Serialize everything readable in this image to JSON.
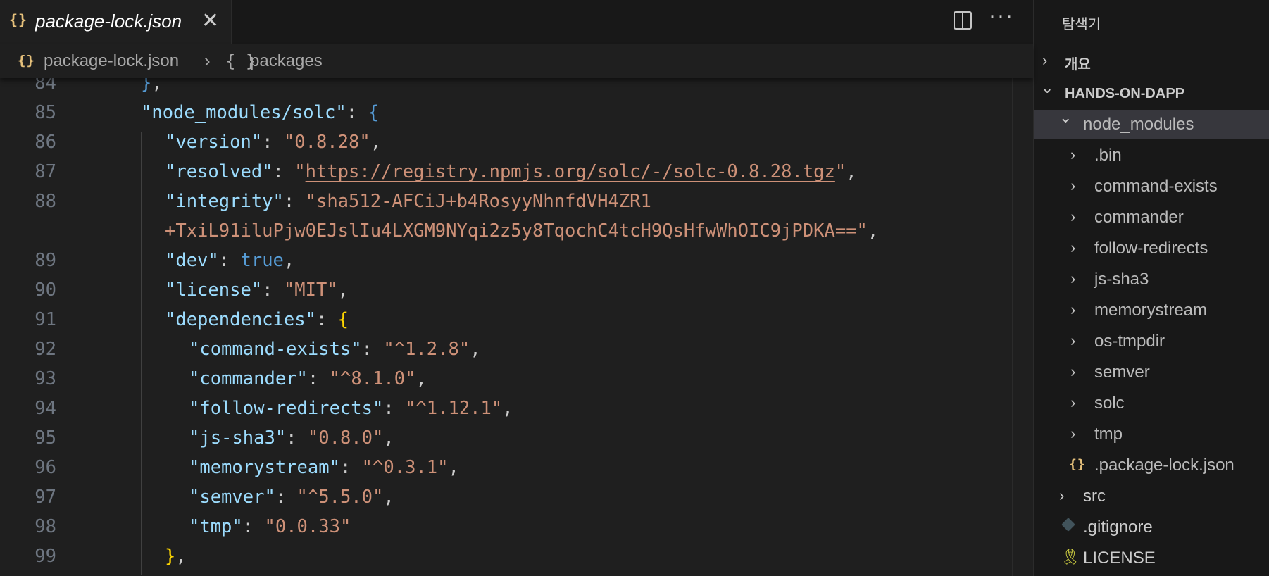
{
  "editor": {
    "tab": {
      "icon": "json-braces-icon",
      "title": "package-lock.json",
      "close": "✕"
    },
    "actions": {
      "split": "split-editor-icon",
      "more": "···"
    },
    "breadcrumb": {
      "file": "package-lock.json",
      "separator": "›",
      "object_icon": "{ }",
      "object": "packages"
    },
    "lines": [
      {
        "n": "84",
        "indent": 2,
        "tokens": [
          [
            "}",
            "b"
          ],
          [
            ",",
            "p"
          ]
        ]
      },
      {
        "n": "85",
        "indent": 2,
        "tokens": [
          [
            "\"node_modules/solc\"",
            "k"
          ],
          [
            ": ",
            "p"
          ],
          [
            "{",
            "b"
          ]
        ]
      },
      {
        "n": "86",
        "indent": 3,
        "tokens": [
          [
            "\"version\"",
            "k"
          ],
          [
            ": ",
            "p"
          ],
          [
            "\"0.8.28\"",
            "s"
          ],
          [
            ",",
            "p"
          ]
        ]
      },
      {
        "n": "87",
        "indent": 3,
        "tokens": [
          [
            "\"resolved\"",
            "k"
          ],
          [
            ": ",
            "p"
          ],
          [
            "\"",
            "s"
          ],
          [
            "https://registry.npmjs.org/solc/-/solc-0.8.28.tgz",
            "s u"
          ],
          [
            "\"",
            "s"
          ],
          [
            ",",
            "p"
          ]
        ]
      },
      {
        "n": "88",
        "indent": 3,
        "tokens": [
          [
            "\"integrity\"",
            "k"
          ],
          [
            ": ",
            "p"
          ],
          [
            "\"sha512-AFCiJ+b4RosyyNhnfdVH4ZR1",
            "s"
          ]
        ]
      },
      {
        "n": "",
        "indent": 3,
        "tokens": [
          [
            "+TxiL91iluPjw0EJslIu4LXGM9NYqi2z5y8TqochC4tcH9QsHfwWhOIC9jPDKA==\"",
            "s"
          ],
          [
            ",",
            "p"
          ]
        ]
      },
      {
        "n": "89",
        "indent": 3,
        "tokens": [
          [
            "\"dev\"",
            "k"
          ],
          [
            ": ",
            "p"
          ],
          [
            "true",
            "b"
          ],
          [
            ",",
            "p"
          ]
        ]
      },
      {
        "n": "90",
        "indent": 3,
        "tokens": [
          [
            "\"license\"",
            "k"
          ],
          [
            ": ",
            "p"
          ],
          [
            "\"MIT\"",
            "s"
          ],
          [
            ",",
            "p"
          ]
        ]
      },
      {
        "n": "91",
        "indent": 3,
        "tokens": [
          [
            "\"dependencies\"",
            "k"
          ],
          [
            ": ",
            "p"
          ],
          [
            "{",
            "y"
          ]
        ]
      },
      {
        "n": "92",
        "indent": 4,
        "tokens": [
          [
            "\"command-exists\"",
            "k"
          ],
          [
            ": ",
            "p"
          ],
          [
            "\"^1.2.8\"",
            "s"
          ],
          [
            ",",
            "p"
          ]
        ]
      },
      {
        "n": "93",
        "indent": 4,
        "tokens": [
          [
            "\"commander\"",
            "k"
          ],
          [
            ": ",
            "p"
          ],
          [
            "\"^8.1.0\"",
            "s"
          ],
          [
            ",",
            "p"
          ]
        ]
      },
      {
        "n": "94",
        "indent": 4,
        "tokens": [
          [
            "\"follow-redirects\"",
            "k"
          ],
          [
            ": ",
            "p"
          ],
          [
            "\"^1.12.1\"",
            "s"
          ],
          [
            ",",
            "p"
          ]
        ]
      },
      {
        "n": "95",
        "indent": 4,
        "tokens": [
          [
            "\"js-sha3\"",
            "k"
          ],
          [
            ": ",
            "p"
          ],
          [
            "\"0.8.0\"",
            "s"
          ],
          [
            ",",
            "p"
          ]
        ]
      },
      {
        "n": "96",
        "indent": 4,
        "tokens": [
          [
            "\"memorystream\"",
            "k"
          ],
          [
            ": ",
            "p"
          ],
          [
            "\"^0.3.1\"",
            "s"
          ],
          [
            ",",
            "p"
          ]
        ]
      },
      {
        "n": "97",
        "indent": 4,
        "tokens": [
          [
            "\"semver\"",
            "k"
          ],
          [
            ": ",
            "p"
          ],
          [
            "\"^5.5.0\"",
            "s"
          ],
          [
            ",",
            "p"
          ]
        ]
      },
      {
        "n": "98",
        "indent": 4,
        "tokens": [
          [
            "\"tmp\"",
            "k"
          ],
          [
            ": ",
            "p"
          ],
          [
            "\"0.0.33\"",
            "s"
          ]
        ]
      },
      {
        "n": "99",
        "indent": 3,
        "tokens": [
          [
            "}",
            "y"
          ],
          [
            ",",
            "p"
          ]
        ]
      }
    ]
  },
  "sidebar": {
    "title": "탐색기",
    "outline": {
      "label": "개요",
      "expanded": false
    },
    "workspace": {
      "label": "HANDS-ON-DAPP",
      "expanded": true
    },
    "items": [
      {
        "label": "node_modules",
        "level": 1,
        "kind": "folder",
        "expanded": true,
        "selected": true
      },
      {
        "label": ".bin",
        "level": 2,
        "kind": "folder"
      },
      {
        "label": "command-exists",
        "level": 2,
        "kind": "folder"
      },
      {
        "label": "commander",
        "level": 2,
        "kind": "folder"
      },
      {
        "label": "follow-redirects",
        "level": 2,
        "kind": "folder"
      },
      {
        "label": "js-sha3",
        "level": 2,
        "kind": "folder"
      },
      {
        "label": "memorystream",
        "level": 2,
        "kind": "folder"
      },
      {
        "label": "os-tmpdir",
        "level": 2,
        "kind": "folder"
      },
      {
        "label": "semver",
        "level": 2,
        "kind": "folder"
      },
      {
        "label": "solc",
        "level": 2,
        "kind": "folder"
      },
      {
        "label": "tmp",
        "level": 2,
        "kind": "folder"
      },
      {
        "label": ".package-lock.json",
        "level": 2,
        "kind": "json"
      },
      {
        "label": "src",
        "level": 1,
        "kind": "folder"
      },
      {
        "label": ".gitignore",
        "level": 1,
        "kind": "gitignore"
      },
      {
        "label": "LICENSE",
        "level": 1,
        "kind": "license"
      }
    ]
  },
  "colors": {
    "editor_bg": "#1f1f1f",
    "sidebar_bg": "#181818",
    "key": "#9cdcfe",
    "string": "#ce9178",
    "keyword": "#569cd6",
    "bracket_gold": "#ffd700",
    "line_number": "#6e7681",
    "json_icon": "#e5c07b",
    "selection": "#37373d"
  }
}
